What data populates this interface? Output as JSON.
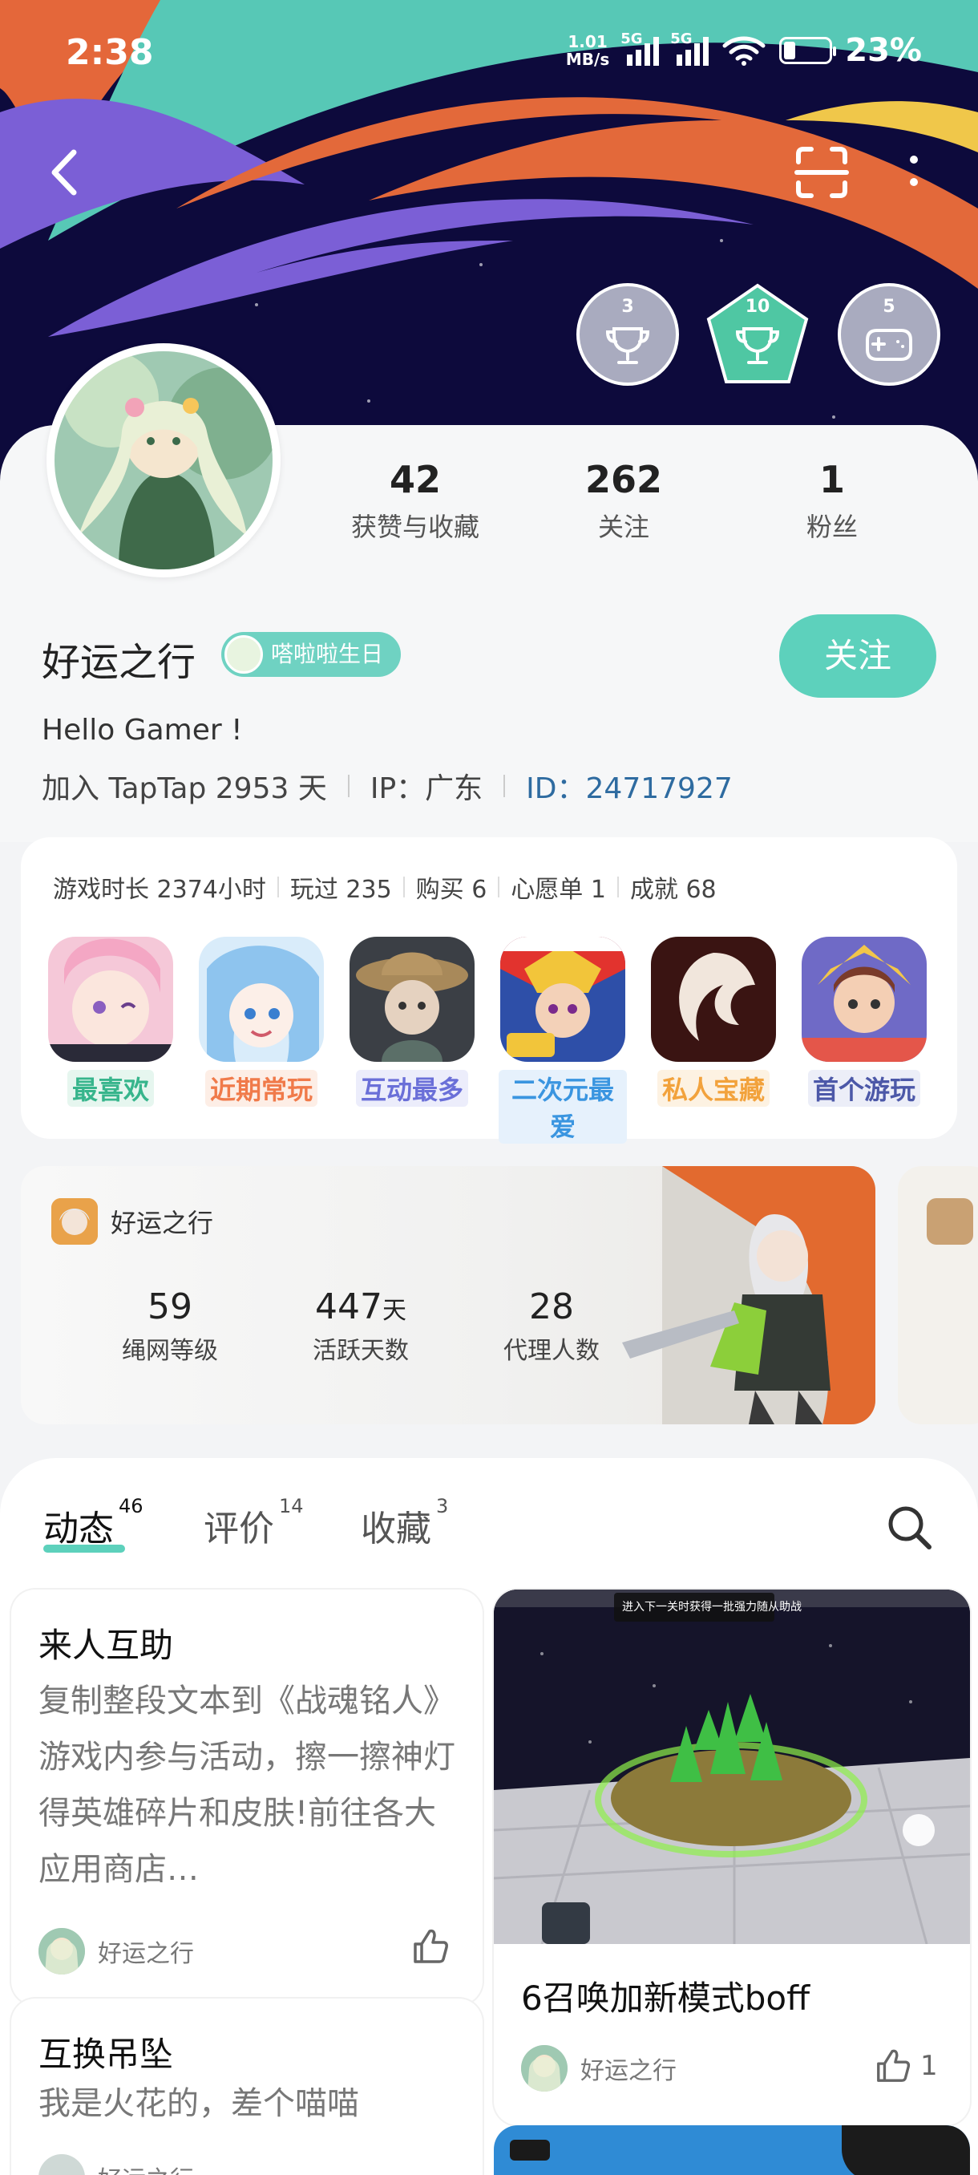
{
  "status_bar": {
    "time": "2:38",
    "net_speed_value": "1.01",
    "net_speed_unit": "MB/s",
    "signal_1": "5G",
    "signal_2": "5G",
    "battery": "23%"
  },
  "header": {
    "icons": [
      "back-icon",
      "scan-icon",
      "more-icon"
    ],
    "badges": [
      {
        "count": "3",
        "color": "#a9abbf"
      },
      {
        "count": "10",
        "color": "#4fc7a3"
      },
      {
        "count": "5",
        "color": "#a9abbf"
      }
    ]
  },
  "profile": {
    "stats": [
      {
        "value": "42",
        "label": "获赞与收藏"
      },
      {
        "value": "262",
        "label": "关注"
      },
      {
        "value": "1",
        "label": "粉丝"
      }
    ],
    "username": "好运之行",
    "tag": "嗒啦啦生日",
    "follow_label": "关注",
    "bio": "Hello Gamer !",
    "joined": "加入 TapTap 2953 天",
    "ip": "IP：广东",
    "id_label": "ID：",
    "id_value": "24717927"
  },
  "games": {
    "summary": [
      "游戏时长 2374小时",
      "玩过 235",
      "购买 6",
      "心愿单 1",
      "成就 68"
    ],
    "items": [
      {
        "label": "最喜欢",
        "color": "#37b58c",
        "bg": "#e6f6ef"
      },
      {
        "label": "近期常玩",
        "color": "#f07a4a",
        "bg": "#fdeee6"
      },
      {
        "label": "互动最多",
        "color": "#6a6fd8",
        "bg": "#ecedfb"
      },
      {
        "label": "二次元最爱",
        "color": "#3a95e0",
        "bg": "#e6f1fc"
      },
      {
        "label": "私人宝藏",
        "color": "#f2a23c",
        "bg": "#fdf2e2"
      },
      {
        "label": "首个游玩",
        "color": "#4c58a8",
        "bg": "#eceef8"
      }
    ]
  },
  "rank_card": {
    "user": "好运之行",
    "stats": [
      {
        "value": "59",
        "unit": "",
        "label": "绳网等级"
      },
      {
        "value": "447",
        "unit": "天",
        "label": "活跃天数"
      },
      {
        "value": "28",
        "unit": "",
        "label": "代理人数"
      }
    ]
  },
  "feed": {
    "tabs": [
      {
        "label": "动态",
        "count": "46"
      },
      {
        "label": "评价",
        "count": "14"
      },
      {
        "label": "收藏",
        "count": "3"
      }
    ],
    "posts": [
      {
        "title": "来人互助",
        "body": "复制整段文本到《战魂铭人》游戏内参与活动，擦一擦神灯得英雄碎片和皮肤!前往各大应用商店…",
        "author": "好运之行"
      },
      {
        "title": "互换吊坠",
        "body": "我是火花的，差个喵喵",
        "author": "好运之行"
      },
      {
        "title": "6召唤加新模式boff",
        "author": "好运之行",
        "likes": "1",
        "screenshot_caption": "进入下一关时获得一批强力随从助战"
      }
    ]
  }
}
